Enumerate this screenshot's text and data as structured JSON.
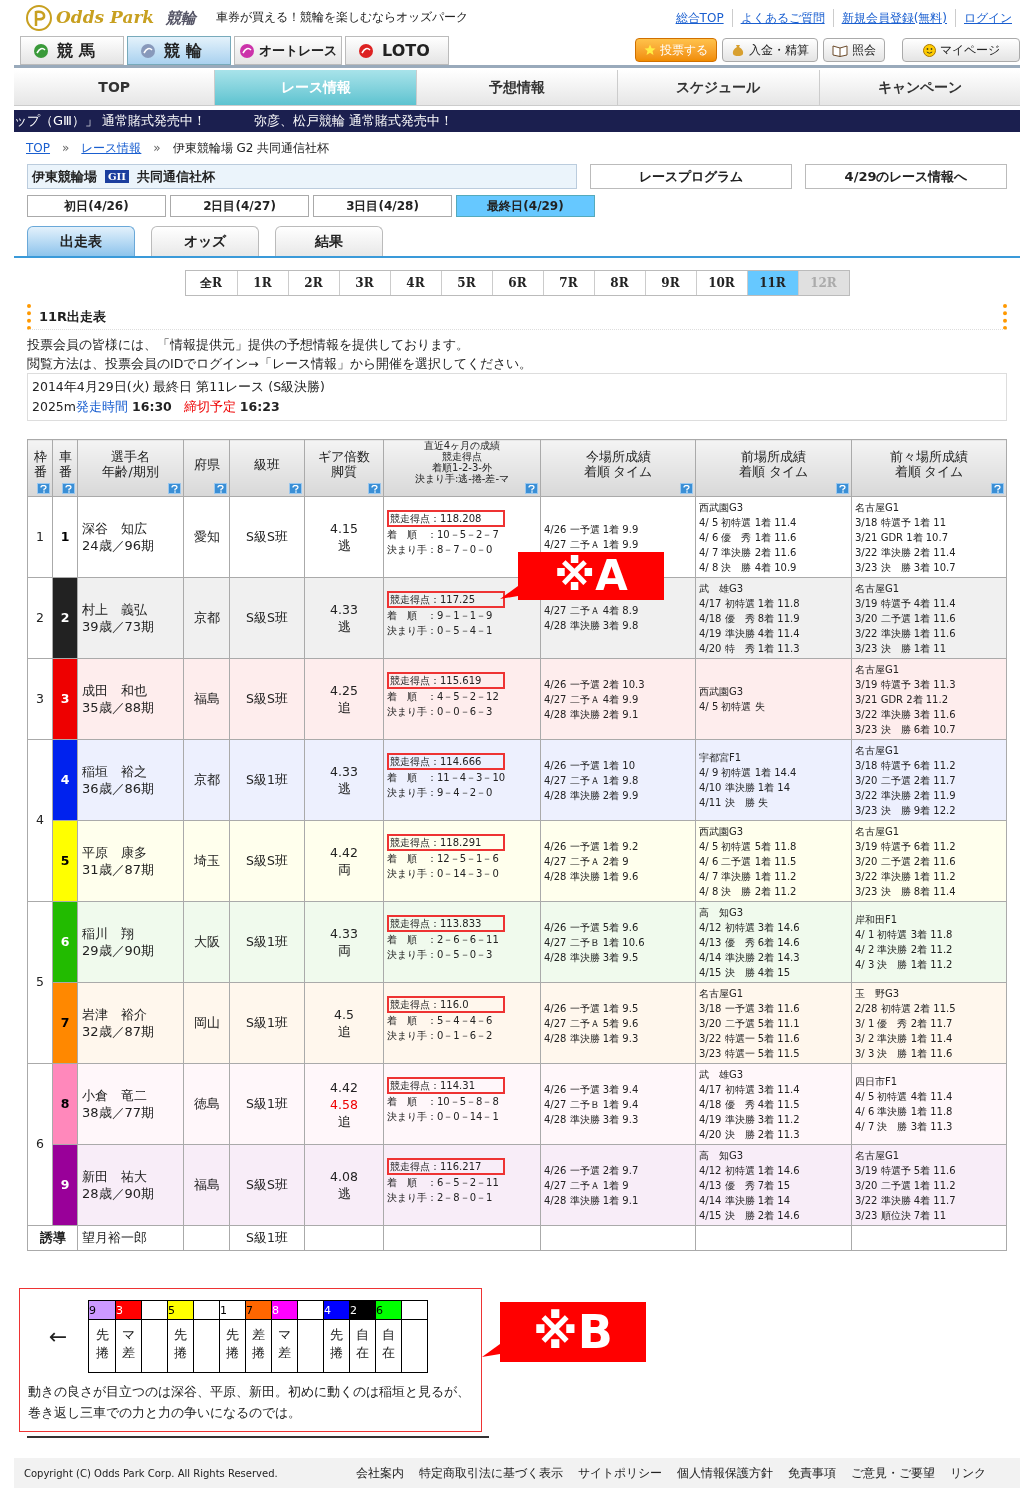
{
  "header": {
    "logo_text": "Odds Park",
    "logo_sub": "競輪",
    "tagline": "車券が買える！競輪を楽しむならオッズパーク",
    "top_links": [
      "総合TOP",
      "よくあるご質問",
      "新規会員登録(無料)",
      "ログイン"
    ],
    "sport_tabs": [
      {
        "label": "競 馬",
        "selected": false
      },
      {
        "label": "競 輪",
        "selected": true
      },
      {
        "label": "オートレース",
        "selected": false
      },
      {
        "label": "LOTO",
        "selected": false
      }
    ],
    "action_buttons": [
      {
        "label": "投票する",
        "kind": "vote"
      },
      {
        "label": "入金・精算",
        "kind": "money"
      },
      {
        "label": "照会",
        "kind": "book"
      },
      {
        "label": "マイページ",
        "kind": "face"
      }
    ]
  },
  "main_nav": [
    {
      "label": "TOP",
      "selected": false
    },
    {
      "label": "レース情報",
      "selected": true
    },
    {
      "label": "予想情報",
      "selected": false
    },
    {
      "label": "スケジュール",
      "selected": false
    },
    {
      "label": "キャンペーン",
      "selected": false
    }
  ],
  "ticker": [
    "ップ（GⅢ）」 通常賭式発売中！",
    "弥彦、松戸競輪  通常賭式発売中！"
  ],
  "breadcrumb_separator": "»",
  "breadcrumb": [
    {
      "label": "TOP",
      "link": true
    },
    {
      "label": "レース情報",
      "link": true
    },
    {
      "label": "伊東競輪場 G2 共同通信社杯",
      "link": false
    }
  ],
  "venue": {
    "name": "伊東競輪場",
    "grade": "GII",
    "race_name": "共同通信社杯"
  },
  "venue_links": [
    "レースプログラム",
    "4/29のレース情報へ"
  ],
  "day_tabs": [
    {
      "label": "初日(4/26)",
      "selected": false
    },
    {
      "label": "2日目(4/27)",
      "selected": false
    },
    {
      "label": "3日目(4/28)",
      "selected": false
    },
    {
      "label": "最終日(4/29)",
      "selected": true
    }
  ],
  "view_tabs": [
    {
      "label": "出走表",
      "selected": true
    },
    {
      "label": "オッズ",
      "selected": false
    },
    {
      "label": "結果",
      "selected": false
    }
  ],
  "race_tabs": [
    {
      "label": "全R",
      "selected": false,
      "disabled": false
    },
    {
      "label": "1R",
      "selected": false,
      "disabled": false
    },
    {
      "label": "2R",
      "selected": false,
      "disabled": false
    },
    {
      "label": "3R",
      "selected": false,
      "disabled": false
    },
    {
      "label": "4R",
      "selected": false,
      "disabled": false
    },
    {
      "label": "5R",
      "selected": false,
      "disabled": false
    },
    {
      "label": "6R",
      "selected": false,
      "disabled": false
    },
    {
      "label": "7R",
      "selected": false,
      "disabled": false
    },
    {
      "label": "8R",
      "selected": false,
      "disabled": false
    },
    {
      "label": "9R",
      "selected": false,
      "disabled": false
    },
    {
      "label": "10R",
      "selected": false,
      "disabled": false
    },
    {
      "label": "11R",
      "selected": true,
      "disabled": false
    },
    {
      "label": "12R",
      "selected": false,
      "disabled": true
    }
  ],
  "section_title": "11R出走表",
  "notice": [
    "投票会員の皆様には、「情報提供元」提供の予想情報を提供しております。",
    "閲覧方法は、投票会員のIDでログイン→「レース情報」から開催を選択してください。"
  ],
  "race_info": {
    "line1": "2014年4月29日(火) 最終日 第11レース (S級決勝)",
    "distance": "2025m",
    "start_label": "発走時間",
    "start_time": "16:30",
    "close_label": "締切予定",
    "close_time": "16:23"
  },
  "columns": [
    {
      "lines": [
        "枠",
        "番"
      ]
    },
    {
      "lines": [
        "車",
        "番"
      ]
    },
    {
      "lines": [
        "選手名",
        "年齢/期別"
      ]
    },
    {
      "lines": [
        "府県"
      ]
    },
    {
      "lines": [
        "級班"
      ]
    },
    {
      "lines": [
        "ギア倍数",
        "脚質"
      ]
    },
    {
      "lines": [
        "直近4ヶ月の成績",
        "競走得点",
        "着順1-2-3-外",
        "決まり手:逃-捲-差-マ"
      ]
    },
    {
      "lines": [
        "今場所成績",
        "着順 タイム"
      ]
    },
    {
      "lines": [
        "前場所成績",
        "着順 タイム"
      ]
    },
    {
      "lines": [
        "前々場所成績",
        "着順 タイム"
      ]
    }
  ],
  "waku_groups": [
    {
      "waku": "1",
      "riders": [
        {
          "car": "1",
          "color": "#ffffff",
          "name": "深谷　知広",
          "age": "24歳／96期",
          "pref": "愛知",
          "class": "S級S班",
          "gear": "4.15",
          "style": "逃",
          "score": "競走得点：118.208",
          "order": "着　順　：10－5－2－7",
          "kimarite": "決まり手：8－7－0－0",
          "current": [
            "4/26 一予選 1着 9.9",
            "4/27 二予Ａ 1着 9.9"
          ],
          "prev": [
            "西武園G3",
            "4/ 5 初特選 1着 11.4",
            "4/ 6 優　秀 1着 11.6",
            "4/ 7 準決勝 2着 11.6",
            "4/ 8 決　勝 4着 10.9"
          ],
          "prev2": [
            "名古屋G1",
            "3/18 特選予 1着 11",
            "3/21 GDR 1着 10.7",
            "3/22 準決勝 2着 11.4",
            "3/23 決　勝 3着 10.7"
          ]
        }
      ]
    },
    {
      "waku": "2",
      "riders": [
        {
          "car": "2",
          "color": "#222222",
          "name": "村上　義弘",
          "age": "39歳／73期",
          "pref": "京都",
          "class": "S級S班",
          "gear": "4.33",
          "style": "逃",
          "score": "競走得点：117.25",
          "order": "着　順　：9－1－1－9",
          "kimarite": "決まり手：0－5－4－1",
          "current": [
            "4/27 二予Ａ 4着 8.9",
            "4/28 準決勝 3着 9.8"
          ],
          "prev": [
            "武　雄G3",
            "4/17 初特選 1着 11.8",
            "4/18 優　秀 8着 11.9",
            "4/19 準決勝 4着 11.4",
            "4/20 特　秀 1着 11.3"
          ],
          "prev2": [
            "名古屋G1",
            "3/19 特選予 4着 11.4",
            "3/20 二予選 1着 11.6",
            "3/22 準決勝 1着 11.6",
            "3/23 決　勝 1着 11"
          ]
        }
      ]
    },
    {
      "waku": "3",
      "riders": [
        {
          "car": "3",
          "color": "#ee0000",
          "name": "成田　和也",
          "age": "35歳／88期",
          "pref": "福島",
          "class": "S級S班",
          "gear": "4.25",
          "style": "追",
          "score": "競走得点：115.619",
          "order": "着　順　：4－5－2－12",
          "kimarite": "決まり手：0－0－6－3",
          "current": [
            "4/26 一予選 2着 10.3",
            "4/27 二予Ａ 4着 9.9",
            "4/28 準決勝 2着 9.1"
          ],
          "prev": [
            "西武園G3",
            "4/ 5 初特選 失"
          ],
          "prev2": [
            "名古屋G1",
            "3/19 特選予 3着 11.3",
            "3/21 GDR 2着 11.2",
            "3/22 準決勝 3着 11.6",
            "3/23 決　勝 6着 10.7"
          ]
        }
      ]
    },
    {
      "waku": "4",
      "riders": [
        {
          "car": "4",
          "color": "#0022ee",
          "name": "稲垣　裕之",
          "age": "36歳／86期",
          "pref": "京都",
          "class": "S級1班",
          "gear": "4.33",
          "style": "逃",
          "score": "競走得点：114.666",
          "order": "着　順　：11－4－3－10",
          "kimarite": "決まり手：9－4－2－0",
          "current": [
            "4/26 一予選 1着 10",
            "4/27 二予Ａ 1着 9.8",
            "4/28 準決勝 2着 9.9"
          ],
          "prev": [
            "宇都宮F1",
            "4/ 9 初特選 1着 14.4",
            "4/10 準決勝 1着 14",
            "4/11 決　勝 失"
          ],
          "prev2": [
            "名古屋G1",
            "3/18 特選予 6着 11.2",
            "3/20 二予選 2着 11.7",
            "3/22 準決勝 2着 11.9",
            "3/23 決　勝 9着 12.2"
          ]
        },
        {
          "car": "5",
          "color": "#ffff00",
          "name": "平原　康多",
          "age": "31歳／87期",
          "pref": "埼玉",
          "class": "S級S班",
          "gear": "4.42",
          "style": "両",
          "score": "競走得点：118.291",
          "order": "着　順　：12－5－1－6",
          "kimarite": "決まり手：0－14－3－0",
          "current": [
            "4/26 一予選 1着 9.2",
            "4/27 二予Ａ 2着 9",
            "4/28 準決勝 1着 9.6"
          ],
          "prev": [
            "西武園G3",
            "4/ 5 初特選 5着 11.8",
            "4/ 6 二予選 1着 11.5",
            "4/ 7 準決勝 1着 11.2",
            "4/ 8 決　勝 2着 11.2"
          ],
          "prev2": [
            "名古屋G1",
            "3/19 特選予 6着 11.2",
            "3/20 二予選 2着 11.6",
            "3/22 準決勝 1着 11.2",
            "3/23 決　勝 8着 11.4"
          ]
        }
      ]
    },
    {
      "waku": "5",
      "riders": [
        {
          "car": "6",
          "color": "#22bb00",
          "name": "稲川　翔",
          "age": "29歳／90期",
          "pref": "大阪",
          "class": "S級1班",
          "gear": "4.33",
          "style": "両",
          "score": "競走得点：113.833",
          "order": "着　順　：2－6－6－11",
          "kimarite": "決まり手：0－5－0－3",
          "current": [
            "4/26 一予選 5着 9.6",
            "4/27 二予Ｂ 1着 10.6",
            "4/28 準決勝 3着 9.5"
          ],
          "prev": [
            "高　知G3",
            "4/12 初特選 3着 14.6",
            "4/13 優　秀 6着 14.6",
            "4/14 準決勝 2着 14.3",
            "4/15 決　勝 4着 15"
          ],
          "prev2": [
            "岸和田F1",
            "4/ 1 初特選 3着 11.8",
            "4/ 2 準決勝 2着 11.2",
            "4/ 3 決　勝 1着 11.2"
          ]
        },
        {
          "car": "7",
          "color": "#ff8800",
          "name": "岩津　裕介",
          "age": "32歳／87期",
          "pref": "岡山",
          "class": "S級1班",
          "gear": "4.5",
          "style": "追",
          "score": "競走得点：116.0",
          "order": "着　順　：5－4－4－6",
          "kimarite": "決まり手：0－1－6－2",
          "current": [
            "4/26 一予選 1着 9.5",
            "4/27 二予Ａ 5着 9.6",
            "4/28 準決勝 1着 9.3"
          ],
          "prev": [
            "名古屋G1",
            "3/18 一予選 3着 11.6",
            "3/20 二予選 5着 11.1",
            "3/22 特選一 5着 11.6",
            "3/23 特選一 5着 11.5"
          ],
          "prev2": [
            "玉　野G3",
            "2/28 初特選 2着 11.5",
            "3/ 1 優　秀 2着 11.7",
            "3/ 2 準決勝 1着 11.4",
            "3/ 3 決　勝 1着 11.6"
          ]
        }
      ]
    },
    {
      "waku": "6",
      "riders": [
        {
          "car": "8",
          "color": "#ff88bb",
          "name": "小倉　竜二",
          "age": "38歳／77期",
          "pref": "徳島",
          "class": "S級1班",
          "gear": "4.42",
          "gear_alt": "4.58",
          "style": "追",
          "score": "競走得点：114.31",
          "order": "着　順　：10－5－8－8",
          "kimarite": "決まり手：0－0－14－1",
          "current": [
            "4/26 一予選 3着 9.4",
            "4/27 二予Ｂ 1着 9.4",
            "4/28 準決勝 3着 9.3"
          ],
          "prev": [
            "武　雄G3",
            "4/17 初特選 3着 11.4",
            "4/18 優　秀 4着 11.5",
            "4/19 準決勝 3着 11.2",
            "4/20 決　勝 2着 11.3"
          ],
          "prev2": [
            "四日市F1",
            "4/ 5 初特選 4着 11.4",
            "4/ 6 準決勝 1着 11.8",
            "4/ 7 決　勝 3着 11.3"
          ]
        },
        {
          "car": "9",
          "color": "#990099",
          "name": "新田　祐大",
          "age": "28歳／90期",
          "pref": "福島",
          "class": "S級S班",
          "gear": "4.08",
          "style": "逃",
          "score": "競走得点：116.217",
          "order": "着　順　：6－5－2－11",
          "kimarite": "決まり手：2－8－0－1",
          "current": [
            "4/26 一予選 2着 9.7",
            "4/27 二予Ａ 1着 9",
            "4/28 準決勝 1着 9.1"
          ],
          "prev": [
            "高　知G3",
            "4/12 初特選 1着 14.6",
            "4/13 優　秀 7着 15",
            "4/14 準決勝 1着 14",
            "4/15 決　勝 2着 14.6"
          ],
          "prev2": [
            "名古屋G1",
            "3/19 特選予 5着 11.6",
            "3/20 二予選 1着 11.2",
            "3/22 準決勝 4着 11.7",
            "3/23 順位決 7着 11"
          ]
        }
      ]
    }
  ],
  "guide": {
    "label": "誘導",
    "name": "望月裕一郎",
    "class": "S級1班"
  },
  "callouts": [
    "※A",
    "※B"
  ],
  "line_prediction": {
    "arrow": "←",
    "cells": [
      {
        "car": "9",
        "color": "#cc99ff",
        "style": "先捲"
      },
      {
        "car": "3",
        "color": "#ff0000",
        "style": "マ差"
      },
      {},
      {
        "car": "5",
        "color": "#ffff00",
        "style": "先捲"
      },
      {},
      {
        "car": "1",
        "color": "#ffffff",
        "style": "先捲"
      },
      {
        "car": "7",
        "color": "#ff6600",
        "style": "差捲"
      },
      {
        "car": "8",
        "color": "#ff00ff",
        "style": "マ差"
      },
      {},
      {
        "car": "4",
        "color": "#0000ff",
        "style": "先捲"
      },
      {
        "car": "2",
        "color": "#000000",
        "style": "自在"
      },
      {
        "car": "6",
        "color": "#00ff00",
        "style": "自在"
      },
      {}
    ]
  },
  "comment": "動きの良さが目立つのは深谷、平原、新田。初めに動くのは稲垣と見るが、巻き返し三車での力と力の争いになるのでは。",
  "footer": {
    "copyright": "Copyright (C) Odds Park Corp. All Rights Reserved.",
    "links": [
      "会社案内",
      "特定商取引法に基づく表示",
      "サイトポリシー",
      "個人情報保護方針",
      "免責事項",
      "ご意見・ご要望",
      "リンク"
    ]
  }
}
